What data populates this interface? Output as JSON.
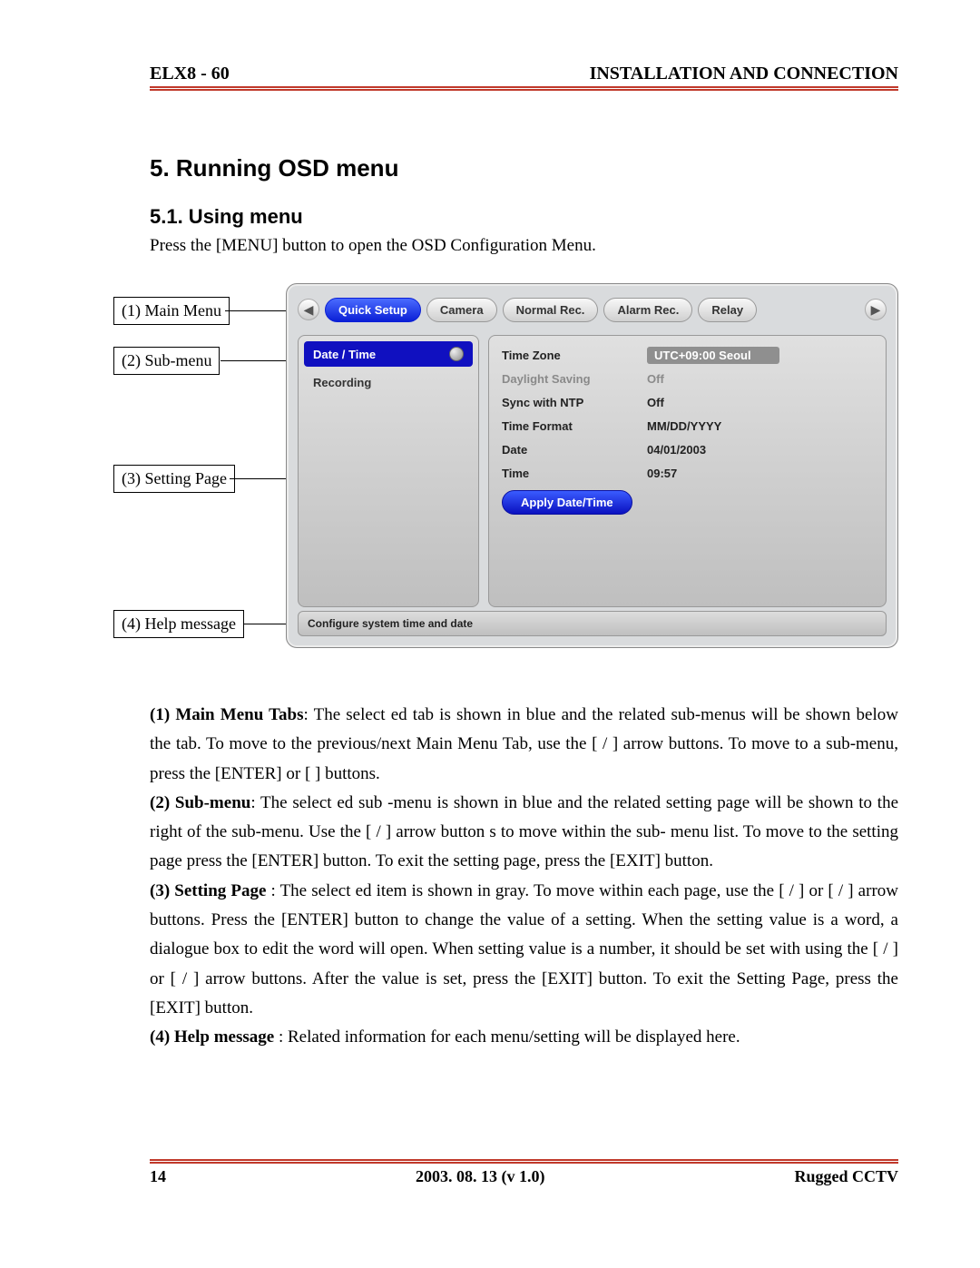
{
  "header": {
    "left": "ELX8 - 60",
    "right": "INSTALLATION AND CONNECTION"
  },
  "section": {
    "title": "5.  Running OSD menu",
    "sub": "5.1.  Using menu",
    "intro": "Press the [MENU] button to open the OSD Configuration Menu."
  },
  "callouts": {
    "c1": "(1) Main Menu",
    "c2": "(2) Sub-menu",
    "c3": "(3) Setting Page",
    "c4": "(4) Help message"
  },
  "osd": {
    "tabs": [
      "Quick Setup",
      "Camera",
      "Normal Rec.",
      "Alarm Rec.",
      "Relay"
    ],
    "active_tab": 0,
    "submenu": [
      "Date / Time",
      "Recording"
    ],
    "active_sub": 0,
    "settings": [
      {
        "label": "Time Zone",
        "value": "UTC+09:00 Seoul",
        "selected": true,
        "dim": false
      },
      {
        "label": "Daylight Saving",
        "value": "Off",
        "selected": false,
        "dim": true
      },
      {
        "label": "Sync with NTP",
        "value": "Off",
        "selected": false,
        "dim": false
      },
      {
        "label": "Time Format",
        "value": "MM/DD/YYYY",
        "selected": false,
        "dim": false
      },
      {
        "label": "Date",
        "value": "04/01/2003",
        "selected": false,
        "dim": false
      },
      {
        "label": "Time",
        "value": "09:57",
        "selected": false,
        "dim": false
      }
    ],
    "apply": "Apply Date/Time",
    "help": "Configure system time and date"
  },
  "desc": {
    "p1a": "(1) Main Menu Tabs",
    "p1b": ": The select ed tab is shown in blue and the related sub-menus will be shown below the tab. To move to the previous/next Main Menu Tab, use the [        /        ] arrow buttons. To move to a sub-menu, press the [ENTER] or [   ] buttons.",
    "p2a": "(2) Sub-menu",
    "p2b": ": The select ed sub -menu is shown in blue and the related setting page will be shown to the right of the sub-menu. Use the [  /  ] arrow button s to move within the sub- menu list. To move to the setting page press the [ENTER] button. To exit the setting page, press the [EXIT] button.",
    "p3a": "(3) Setting Page",
    "p3b": " : The select ed item is shown in gray. To move within each page, use the [        /        ] or [  /  ] arrow buttons. Press the [ENTER] button to change the value of a setting. When the setting value is a word, a dialogue box to edit the word will open. When setting value is a number, it should be set with using the [        /        ] or [  /  ] arrow buttons. After the value is set, press the [EXIT] button. To exit the Setting Page, press the [EXIT] button.",
    "p4a": "(4) Help message",
    "p4b": " : Related information for each menu/setting will be displayed here."
  },
  "footer": {
    "page": "14",
    "date": "2003. 08. 13 (v 1.0)",
    "brand": "Rugged CCTV"
  }
}
